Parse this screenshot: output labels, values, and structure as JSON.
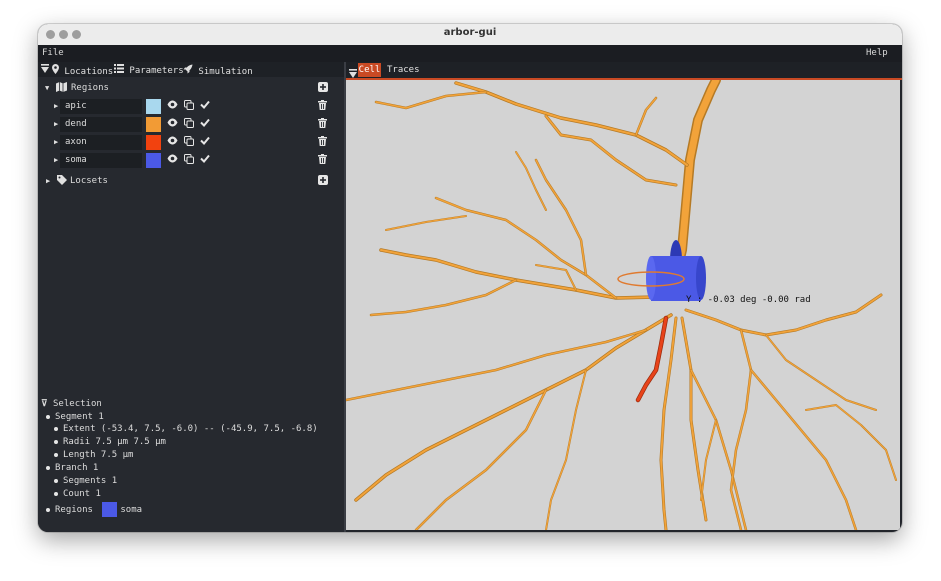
{
  "window": {
    "title": "arbor-gui"
  },
  "menubar": {
    "file": "File",
    "help": "Help"
  },
  "left_tabs": {
    "locations": "Locations",
    "parameters": "Parameters",
    "simulation": "Simulation"
  },
  "regions": {
    "header": "Regions",
    "items": [
      {
        "label": "apic",
        "color": "#a9d8ee"
      },
      {
        "label": "dend",
        "color": "#f29b35"
      },
      {
        "label": "axon",
        "color": "#f2420f"
      },
      {
        "label": "soma",
        "color": "#4b59e6"
      }
    ]
  },
  "locsets": {
    "header": "Locsets"
  },
  "selection": {
    "header": "Selection",
    "segment": "Segment 1",
    "extent": "Extent (-53.4, 7.5, -6.0) -- (-45.9, 7.5, -6.8)",
    "radii": "Radii  7.5 µm 7.5 µm",
    "length": "Length 7.5 µm",
    "branch": "Branch 1",
    "segments": "Segments 1",
    "count": "Count 1",
    "regions_label": "Regions",
    "region_value": "soma",
    "region_color": "#4b59e6"
  },
  "view_tabs": {
    "cell": "Cell",
    "traces": "Traces"
  },
  "viewport": {
    "rotation_readout": "Y : -0.03 deg -0.00 rad"
  },
  "colors": {
    "accent": "#c94a24",
    "dendrite": "#f2a33a",
    "axon": "#e8431a",
    "soma": "#4b59e6",
    "viewport_bg": "#d3d3d3"
  }
}
